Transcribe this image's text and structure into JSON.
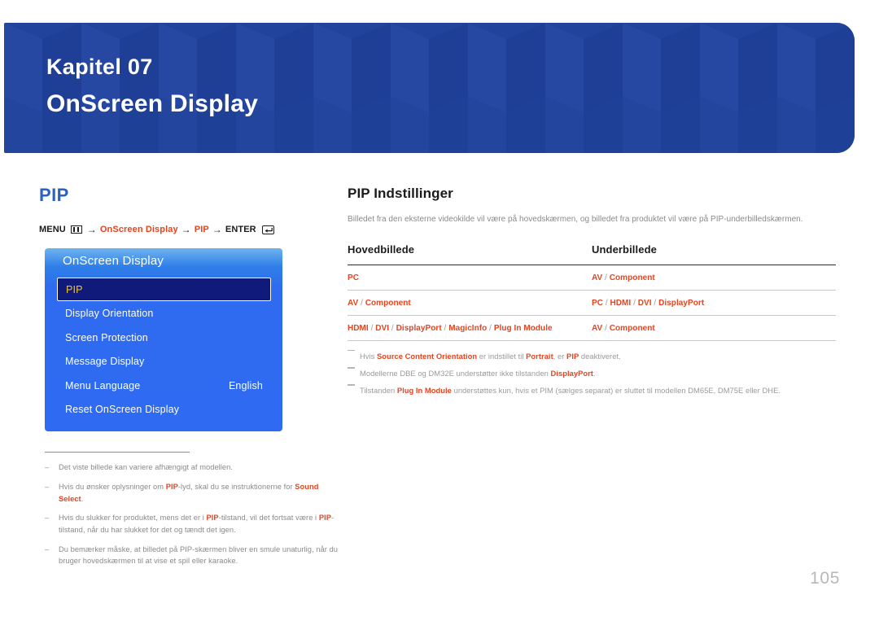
{
  "banner": {
    "chapter_label": "Kapitel 07",
    "chapter_title": "OnScreen Display",
    "background_color": "#21439C"
  },
  "left_column": {
    "section_title": "PIP",
    "section_title_color": "#2A62C4",
    "breadcrumb": {
      "menu_label": "MENU",
      "menu_icon": "menu-bars-icon",
      "arrow": "→",
      "step1": "OnScreen Display",
      "step2": "PIP",
      "enter_label": "ENTER",
      "enter_icon": "enter-return-icon",
      "accent_color": "#E8431F"
    },
    "osd_panel": {
      "title": "OnScreen Display",
      "selected_index": 0,
      "selected_text_color": "#F5C518",
      "items": [
        {
          "label": "PIP",
          "value": ""
        },
        {
          "label": "Display Orientation",
          "value": ""
        },
        {
          "label": "Screen Protection",
          "value": ""
        },
        {
          "label": "Message Display",
          "value": ""
        },
        {
          "label": "Menu Language",
          "value": "English"
        },
        {
          "label": "Reset OnScreen Display",
          "value": ""
        }
      ]
    },
    "notes": [
      {
        "dash": "–",
        "html": "Det viste billede kan variere afhængigt af modellen."
      },
      {
        "dash": "–",
        "html": "Hvis du ønsker oplysninger om <b>PIP</b>-lyd, skal du se instruktionerne for <b>Sound Select</b>."
      },
      {
        "dash": "–",
        "html": "Hvis du slukker for produktet, mens det er i <b>PIP</b>-tilstand, vil det fortsat være i <b>PIP</b>-tilstand, når du har slukket for det og tændt det igen."
      },
      {
        "dash": "–",
        "html": "Du bemærker måske, at billedet på PIP-skærmen bliver en smule unaturlig, når du bruger hovedskærmen til at vise et spil eller karaoke."
      }
    ]
  },
  "right_column": {
    "sub_title": "PIP Indstillinger",
    "intro": "Billedet fra den eksterne videokilde vil være på hovedskærmen, og billedet fra produktet vil være på PIP-underbilledskærmen.",
    "table": {
      "headers": [
        "Hovedbillede",
        "Underbillede"
      ],
      "rows": [
        {
          "main": "PC",
          "sub": "AV / Component"
        },
        {
          "main": "AV / Component",
          "sub": "PC / HDMI / DVI / DisplayPort"
        },
        {
          "main": "HDMI / DVI / DisplayPort / MagicInfo / Plug In Module",
          "sub": "AV / Component"
        }
      ],
      "value_color": "#E8431F"
    },
    "notes": [
      {
        "html": "Hvis <b>Source Content Orientation</b> er indstillet til <b>Portrait</b>, er <b>PIP</b> deaktiveret."
      },
      {
        "html": "Modellerne DBE og DM32E understøtter ikke tilstanden <b>DisplayPort</b>."
      },
      {
        "html": "Tilstanden <b>Plug In Module</b> understøttes kun, hvis et PIM (sælges separat) er sluttet til modellen DM65E, DM75E eller DHE."
      }
    ]
  },
  "footer": {
    "page_number": "105"
  }
}
